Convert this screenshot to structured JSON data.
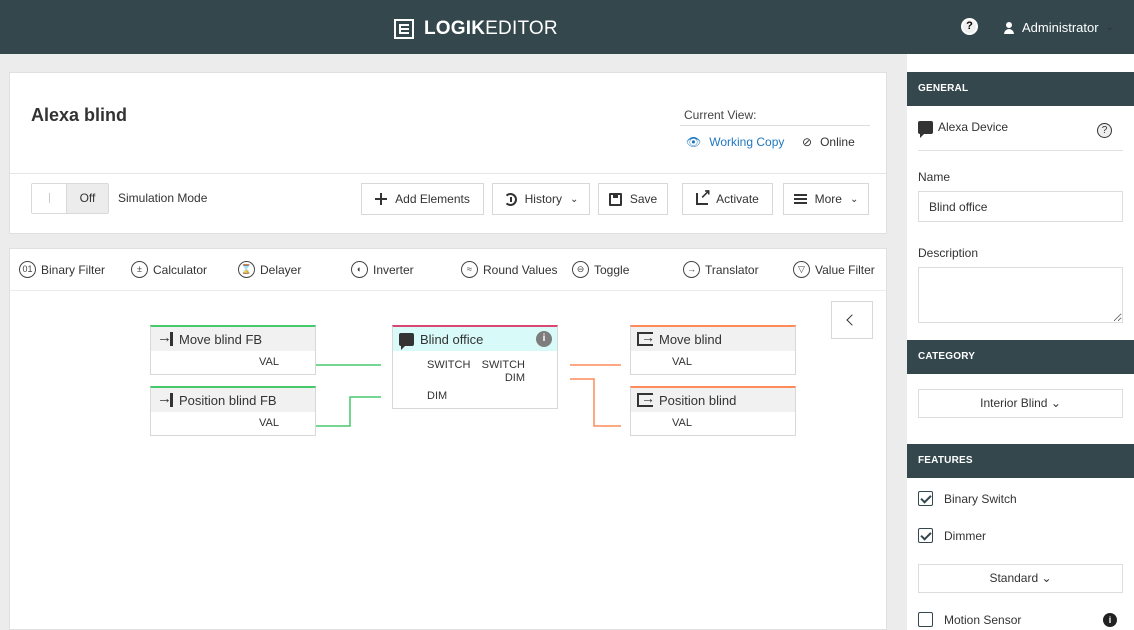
{
  "header": {
    "brand_bold": "LOGIK",
    "brand_light": "EDITOR",
    "help_glyph": "?",
    "user": "Administrator"
  },
  "page": {
    "title": "Alexa blind",
    "current_view_label": "Current View:",
    "working_copy": "Working Copy",
    "online": "Online"
  },
  "toolbar": {
    "toggle_state": "Off",
    "simulation_mode": "Simulation Mode",
    "add_elements": "Add Elements",
    "history": "History",
    "save": "Save",
    "activate": "Activate",
    "more": "More"
  },
  "palette": [
    {
      "label": "Binary Filter",
      "glyph": "01"
    },
    {
      "label": "Calculator",
      "glyph": "±"
    },
    {
      "label": "Delayer",
      "glyph": "⌛"
    },
    {
      "label": "Inverter",
      "glyph": "◐"
    },
    {
      "label": "Round Values",
      "glyph": "≈"
    },
    {
      "label": "Toggle",
      "glyph": "⊖"
    },
    {
      "label": "Translator",
      "glyph": "→"
    },
    {
      "label": "Value Filter",
      "glyph": "▽"
    }
  ],
  "nodes": {
    "move_fb": {
      "title": "Move blind FB",
      "out": "VAL"
    },
    "position_fb": {
      "title": "Position blind FB",
      "out": "VAL"
    },
    "office": {
      "title": "Blind office",
      "in1": "SWITCH",
      "in2": "DIM",
      "out1": "SWITCH",
      "out2": "DIM",
      "info": "i"
    },
    "move": {
      "title": "Move blind",
      "in": "VAL"
    },
    "position": {
      "title": "Position blind",
      "in": "VAL"
    }
  },
  "sidebar": {
    "general": "GENERAL",
    "device": "Alexa Device",
    "name_label": "Name",
    "name_value": "Blind office",
    "description_label": "Description",
    "description_value": "",
    "category": "CATEGORY",
    "category_value": "Interior Blind",
    "features": "FEATURES",
    "binary_switch": "Binary Switch",
    "dimmer": "Dimmer",
    "dimmer_mode": "Standard",
    "motion_sensor": "Motion Sensor",
    "info_glyph": "i"
  },
  "colors": {
    "header_bg": "#33474d",
    "link_blue": "#1f78c1",
    "input_wire": "#46c96b",
    "output_wire": "#ff8b5a",
    "alexa_accent": "#d94773"
  }
}
